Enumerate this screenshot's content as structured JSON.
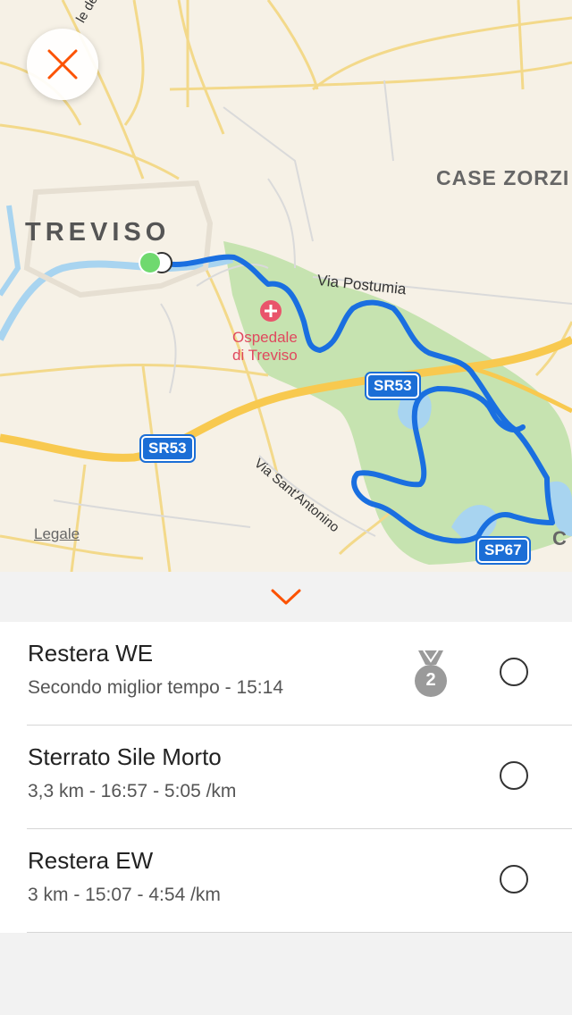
{
  "map": {
    "labels": {
      "city": "TREVISO",
      "case_zorzi": "CASE ZORZI",
      "via_postumia": "Via Postumia",
      "hospital_line1": "Ospedale",
      "hospital_line2": "di Treviso",
      "via_sant_antonino": "Via Sant'Antonino",
      "top_street_fragment": "le de",
      "right_edge_fragment": "C",
      "legal": "Legale"
    },
    "shields": {
      "sr53_a": "SR53",
      "sr53_b": "SR53",
      "sp67": "SP67"
    },
    "colors": {
      "route": "#1a6fe0",
      "park": "#c6e3b0",
      "road": "#f8c94f",
      "water": "#a8d4f0",
      "start_dot": "#6fd96f"
    },
    "close_icon": "close-icon"
  },
  "segments": [
    {
      "title": "Restera WE",
      "subtitle": "Secondo miglior tempo - 15:14",
      "medal": "2",
      "selected": false
    },
    {
      "title": "Sterrato Sile Morto",
      "subtitle": "3,3 km - 16:57 - 5:05 /km",
      "selected": false
    },
    {
      "title": "Restera EW",
      "subtitle": "3 km - 15:07 - 4:54 /km",
      "selected": false
    }
  ],
  "accent_color": "#fc5200"
}
